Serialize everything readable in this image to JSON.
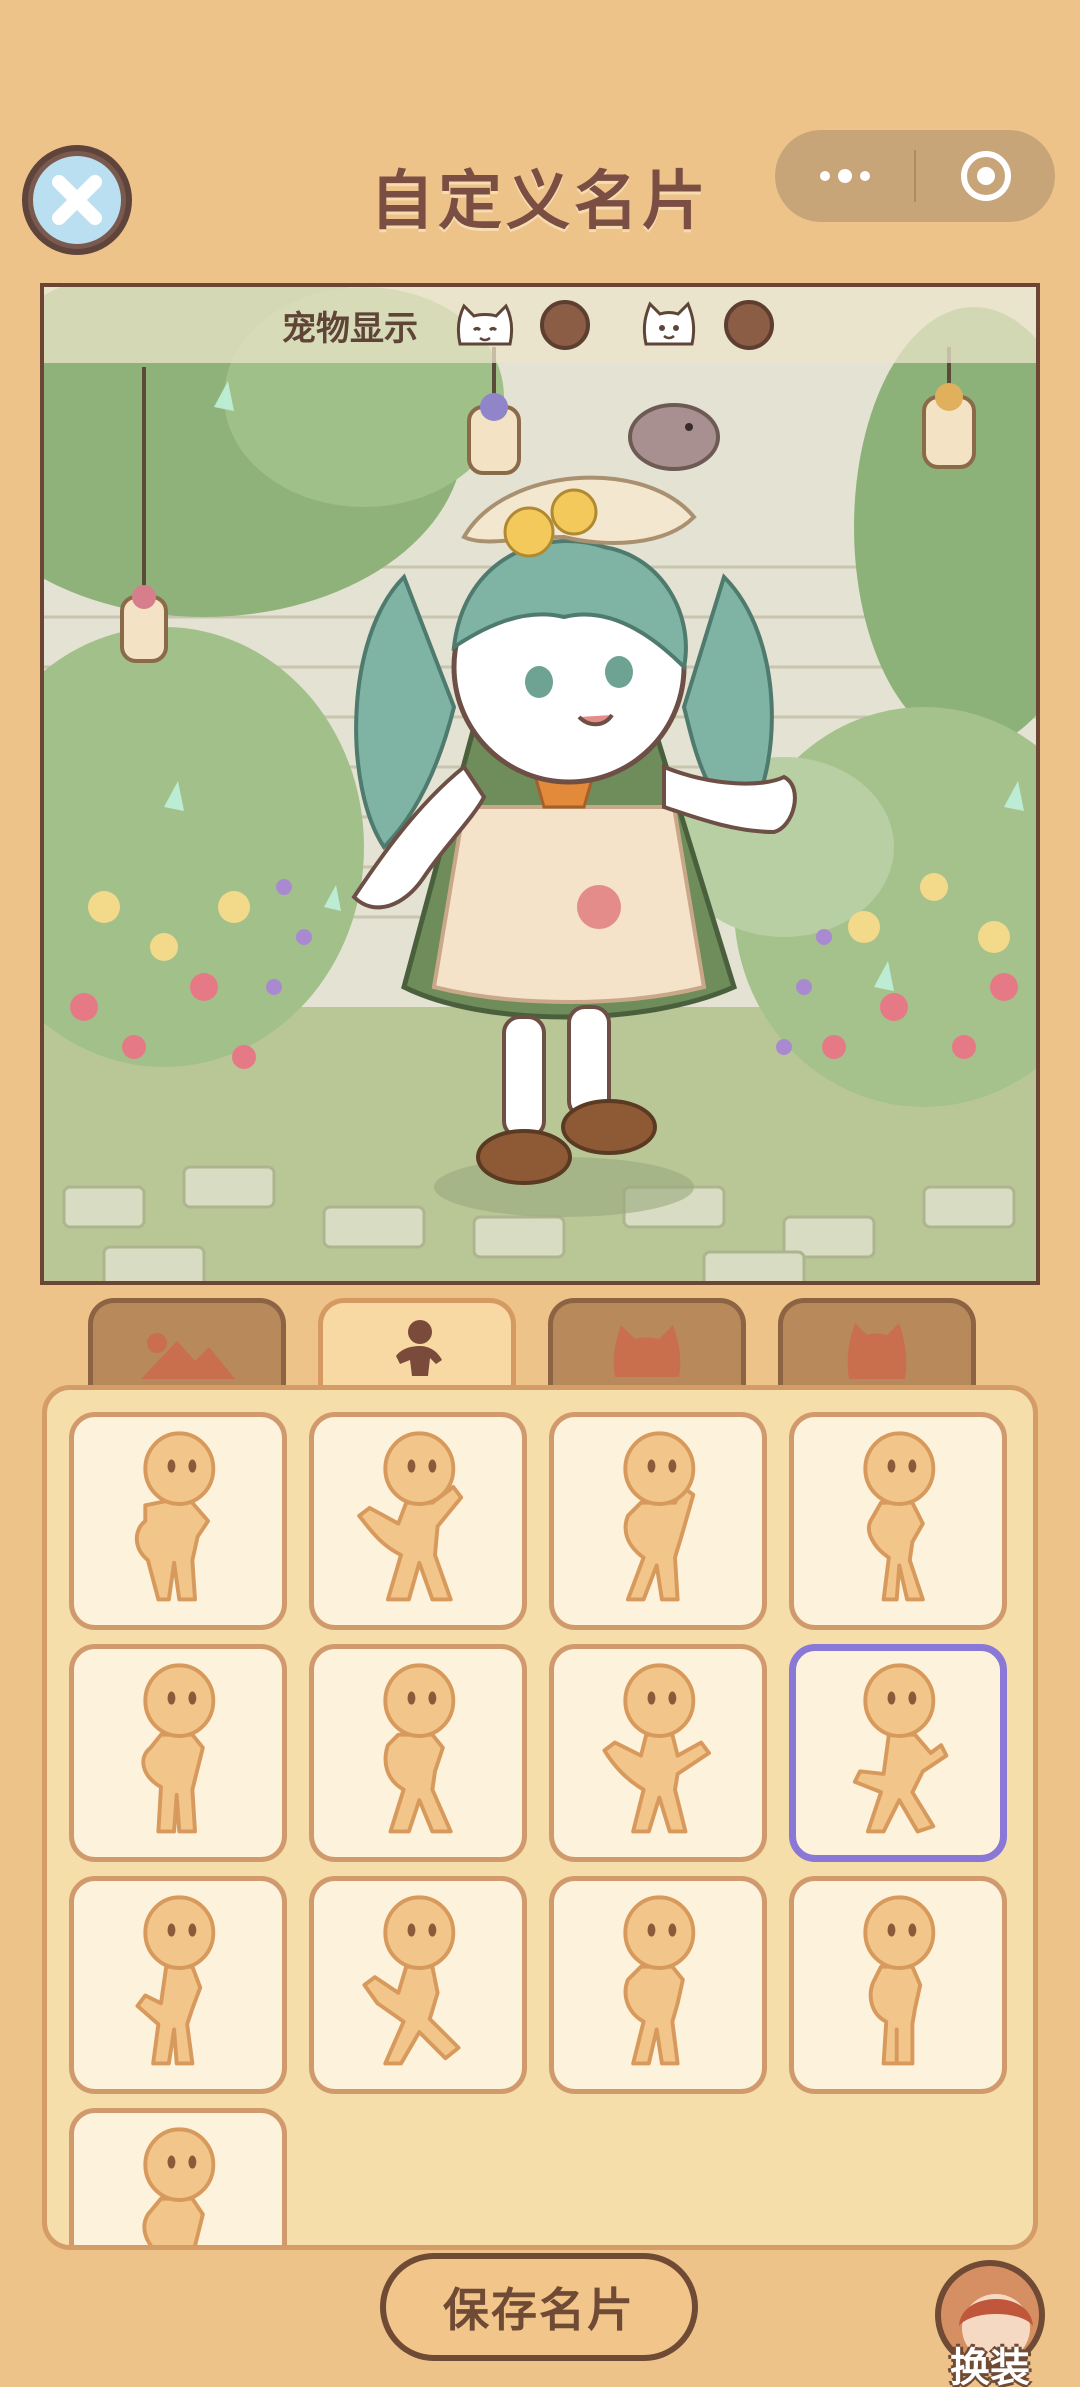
{
  "header": {
    "title": "自定义名片",
    "close_icon": "close-icon",
    "more_icon": "more-dots-icon",
    "target_icon": "target-icon"
  },
  "scene": {
    "pet_label": "宠物显示",
    "pet_slots": [
      {
        "icon": "cat-face-icon",
        "toggle": "off"
      },
      {
        "icon": "cat-face-icon",
        "toggle": "off"
      }
    ],
    "background": "garden-brick-wall",
    "character": "green-hair-lolita-girl"
  },
  "tabs": [
    {
      "icon": "scene-icon",
      "active": false
    },
    {
      "icon": "pose-icon",
      "active": true
    },
    {
      "icon": "cat-icon",
      "active": false
    },
    {
      "icon": "pet-icon",
      "active": false
    }
  ],
  "poses": {
    "count": 13,
    "selected_index": 7
  },
  "footer": {
    "save_label": "保存名片",
    "dress_label": "换装"
  },
  "colors": {
    "background": "#eec38a",
    "title": "#7b4e43",
    "selected_border": "#8a78d6",
    "pose_figure": "#f2c58a"
  }
}
